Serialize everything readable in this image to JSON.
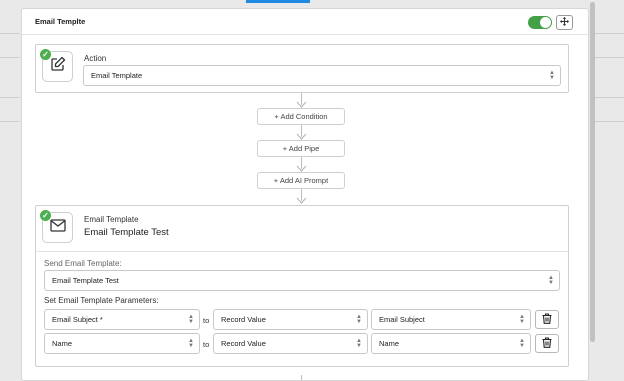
{
  "header": {
    "title": "Email Templte",
    "toggle_on": true
  },
  "action_card": {
    "label": "Action",
    "value": "Email Template"
  },
  "buttons": {
    "add_condition": "+ Add Condition",
    "add_pipe": "+ Add Pipe",
    "add_ai_prompt": "+ Add AI Prompt"
  },
  "email_card": {
    "type_label": "Email Template",
    "name": "Email Template Test",
    "send_label": "Send Email Template:",
    "send_value": "Email Template Test",
    "params_label": "Set Email Template Parameters:",
    "rows": [
      {
        "param": "Email Subject *",
        "to": "to",
        "source": "Record Value",
        "field": "Email Subject"
      },
      {
        "param": "Name",
        "to": "to",
        "source": "Record Value",
        "field": "Name"
      }
    ]
  },
  "colors": {
    "accent": "#43a047",
    "tab_indicator": "#1e88e5"
  },
  "icons": [
    "move-icon",
    "edit-icon",
    "mail-icon",
    "check-icon",
    "trash-icon",
    "chevron-updown-icon"
  ]
}
